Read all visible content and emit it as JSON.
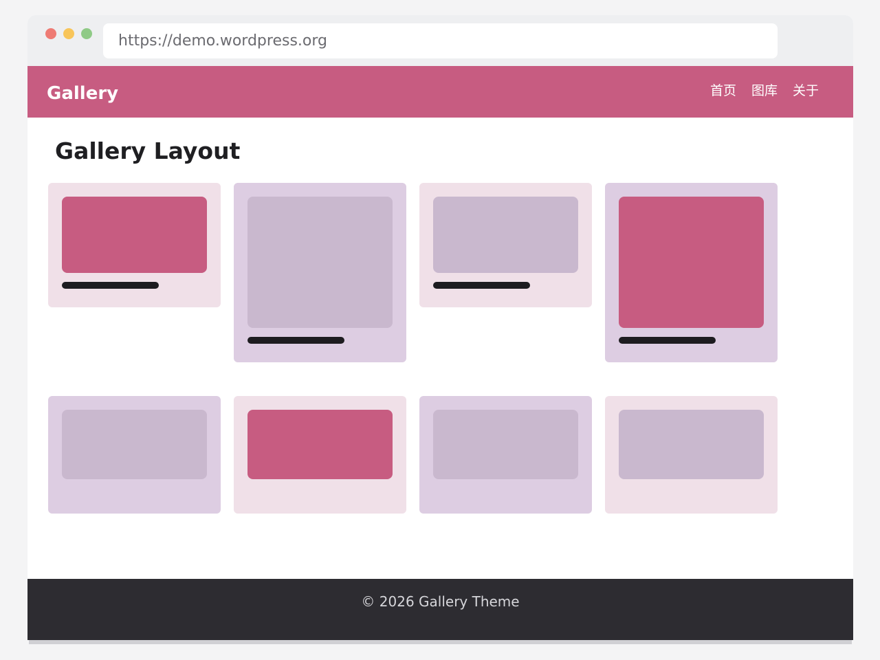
{
  "browser": {
    "url": "https://demo.wordpress.org"
  },
  "header": {
    "site_title": "Gallery",
    "nav": [
      {
        "label": "首页"
      },
      {
        "label": "图库"
      },
      {
        "label": "关于"
      }
    ]
  },
  "main": {
    "heading": "Gallery Layout",
    "cards": [
      {
        "thumb_color": "#c75c81",
        "card_color": "#f0e0e8"
      },
      {
        "thumb_color": "#c9b8ce",
        "card_color": "#ddcde2"
      },
      {
        "thumb_color": "#c9b8ce",
        "card_color": "#f0e0e8"
      },
      {
        "thumb_color": "#c75c81",
        "card_color": "#ddcde2"
      },
      {
        "thumb_color": "#c9b8ce",
        "card_color": "#ddcde2"
      },
      {
        "thumb_color": "#c75c81",
        "card_color": "#f0e0e8"
      },
      {
        "thumb_color": "#c9b8ce",
        "card_color": "#ddcde2"
      },
      {
        "thumb_color": "#c9b8ce",
        "card_color": "#f0e0e8"
      }
    ]
  },
  "footer": {
    "text": "© 2026 Gallery Theme"
  },
  "colors": {
    "accent": "#c75c81",
    "footer_bg": "#2d2c31"
  }
}
